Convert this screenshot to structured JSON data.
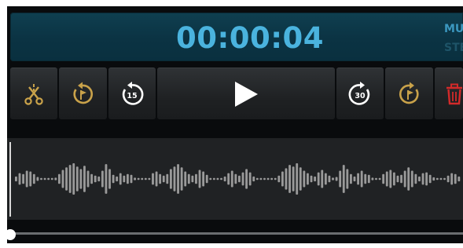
{
  "display": {
    "time": "00:00:04",
    "mode_line1": "MUL",
    "mode_line2": "STERE"
  },
  "toolbar": {
    "rewind_seconds": "15",
    "forward_seconds": "30"
  },
  "icons": {
    "trim": "scissors-icon",
    "back_to_marker": "rewind-flag-icon",
    "rewind": "rewind-15-icon",
    "play": "play-icon",
    "forward": "forward-30-icon",
    "forward_to_marker": "forward-flag-icon",
    "delete": "trash-icon"
  },
  "playback": {
    "position_fraction": 0.0
  },
  "colors": {
    "display_text": "#4ab3de",
    "accent_gold": "#c9a24a",
    "delete_red": "#d32a2a",
    "waveform": "#9a9a9a"
  },
  "waveform": {
    "amplitudes": [
      0.15,
      0.35,
      0.3,
      0.5,
      0.45,
      0.3,
      0.12,
      0.06,
      0.06,
      0.06,
      0.06,
      0.08,
      0.3,
      0.55,
      0.7,
      0.85,
      0.95,
      0.75,
      0.6,
      0.8,
      0.5,
      0.3,
      0.2,
      0.15,
      0.5,
      0.9,
      0.6,
      0.25,
      0.15,
      0.35,
      0.2,
      0.3,
      0.25,
      0.08,
      0.06,
      0.06,
      0.06,
      0.06,
      0.35,
      0.45,
      0.3,
      0.2,
      0.3,
      0.6,
      0.75,
      0.9,
      0.7,
      0.45,
      0.3,
      0.2,
      0.3,
      0.55,
      0.45,
      0.25,
      0.06,
      0.06,
      0.06,
      0.06,
      0.15,
      0.35,
      0.5,
      0.3,
      0.2,
      0.4,
      0.6,
      0.4,
      0.15,
      0.06,
      0.06,
      0.06,
      0.06,
      0.06,
      0.06,
      0.2,
      0.45,
      0.65,
      0.85,
      0.75,
      0.95,
      0.7,
      0.5,
      0.35,
      0.2,
      0.15,
      0.4,
      0.55,
      0.35,
      0.2,
      0.08,
      0.12,
      0.5,
      0.85,
      0.6,
      0.3,
      0.15,
      0.35,
      0.5,
      0.3,
      0.25,
      0.08,
      0.06,
      0.06,
      0.3,
      0.45,
      0.55,
      0.4,
      0.2,
      0.25,
      0.5,
      0.7,
      0.5,
      0.3,
      0.15,
      0.35,
      0.4,
      0.25,
      0.1,
      0.06,
      0.06,
      0.06,
      0.2,
      0.35,
      0.3,
      0.15
    ]
  }
}
